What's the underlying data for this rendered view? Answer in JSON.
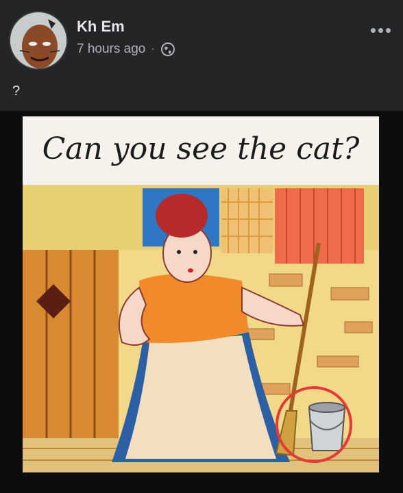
{
  "post": {
    "author": "Kh Em",
    "time": "7 hours ago",
    "separator": "·",
    "caption": "?",
    "icons": {
      "privacy": "globe-icon",
      "more": "more-options-icon"
    }
  },
  "image": {
    "title": "Can you see the cat?"
  },
  "colors": {
    "background": "#242526",
    "text_primary": "#e4e6eb",
    "text_secondary": "#b0b3b8",
    "highlight_circle": "#e53935"
  }
}
